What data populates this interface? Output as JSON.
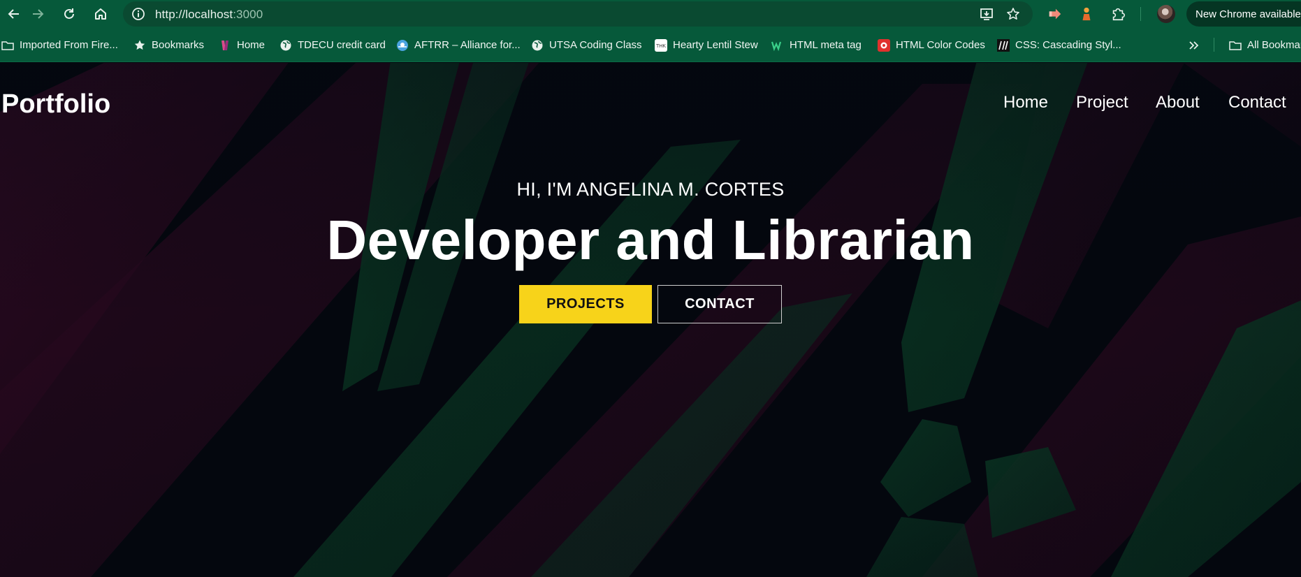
{
  "browser": {
    "url_host": "http://localhost",
    "url_port": ":3000",
    "update_label": "New Chrome available",
    "icons": {
      "back": "arrow-left-icon",
      "forward": "arrow-right-icon",
      "reload": "reload-icon",
      "home": "home-icon",
      "site_info": "info-icon",
      "install": "install-app-icon",
      "bookmark": "star-icon",
      "extensions": "puzzle-icon"
    }
  },
  "bookmarks": [
    {
      "label": "Imported From Fire...",
      "icon": "folder-icon"
    },
    {
      "label": "Bookmarks",
      "icon": "star-icon"
    },
    {
      "label": "Home",
      "icon": "site-favicon"
    },
    {
      "label": "TDECU credit card",
      "icon": "globe-icon"
    },
    {
      "label": "AFTRR – Alliance for...",
      "icon": "site-favicon"
    },
    {
      "label": "UTSA Coding Class",
      "icon": "globe-icon"
    },
    {
      "label": "Hearty Lentil Stew",
      "icon": "site-favicon"
    },
    {
      "label": "HTML meta tag",
      "icon": "site-favicon"
    },
    {
      "label": "HTML Color Codes",
      "icon": "site-favicon"
    },
    {
      "label": "CSS: Cascading Styl...",
      "icon": "site-favicon"
    },
    {
      "label": "All Bookmarks",
      "icon": "folder-icon"
    }
  ],
  "site": {
    "logo": "Portfolio",
    "nav": [
      "Home",
      "Project",
      "About",
      "Contact"
    ],
    "hero_subtitle": "HI, I'M ANGELINA M. CORTES",
    "hero_title": "Developer and Librarian",
    "buttons": {
      "projects": "PROJECTS",
      "contact": "CONTACT"
    }
  },
  "colors": {
    "chrome_bg": "#06593a",
    "omnibox_bg": "#0a4a31",
    "page_bg": "#050811",
    "accent_yellow": "#f7d31a",
    "leaf_green": "#0a3a25",
    "leaf_magenta": "#2a0a1f"
  }
}
